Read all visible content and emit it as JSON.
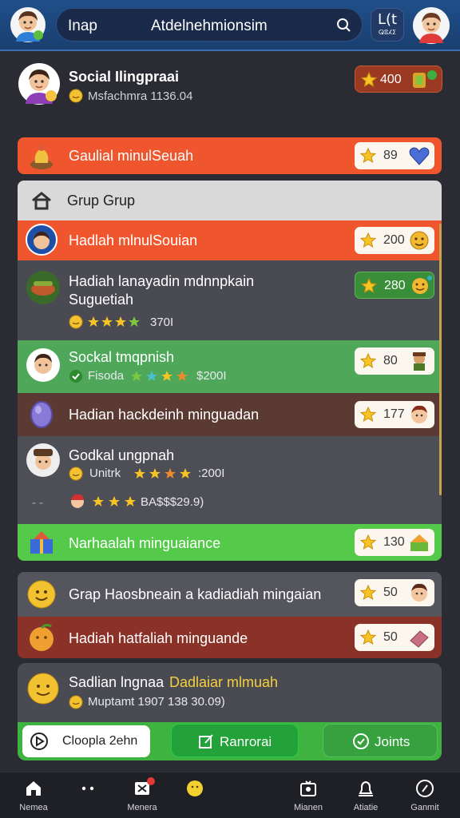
{
  "header": {
    "app_name": "Inap",
    "search_title": "Atdelnehmionsim",
    "lang_big": "L(t",
    "lang_small": "ⵕⵓⵃⵉ"
  },
  "profile": {
    "name": "Social Ilingpraai",
    "subtitle": "Msfachmra 1136.04",
    "score": "400"
  },
  "rows": {
    "row1": {
      "label": "Gaulial minulSeuah",
      "score": "89"
    },
    "group_title": "Grup Grup",
    "row2": {
      "label": "Hadlah mlnulSouian",
      "score": "200"
    },
    "row3": {
      "label_line1": "Hadiah lanayadin mdnnpkain",
      "label_line2": "Suguetiah",
      "meta": "370I",
      "score": "280"
    },
    "row4": {
      "label": "Sockal tmqpnish",
      "meta_label": "Fisoda",
      "meta": "$200I",
      "score": "80"
    },
    "row5": {
      "label": "Hadian hackdeinh minguadan",
      "score": "177"
    },
    "row6": {
      "label": "Godkal ungpnah",
      "meta_label": "Unitrk",
      "meta": ":200I",
      "sub_meta": "BA$$$29.9)",
      "sub_prefix": "- -"
    },
    "row7": {
      "label": "Narhaalah minguaiance",
      "score": "130"
    },
    "row8": {
      "label": "Grap Haosbneain a kadiadiah mingaian",
      "score": "50"
    },
    "row9": {
      "label": "Hadiah hatfaliah minguande",
      "score": "50"
    },
    "row10": {
      "label_a": "Sadlian lngnaa",
      "label_b": "Dadlaiar mlmuah",
      "meta": "Muptamt 1907 138 30.09)"
    }
  },
  "actions": {
    "white_button": "Cloopla 2ehn",
    "green_button": "Ranrorai",
    "green2_button": "Joints"
  },
  "nav": {
    "home": "Nemea",
    "more": "",
    "menu": "Menera",
    "center": "",
    "messages": "Mianen",
    "alerts": "Atiatie",
    "account": "Ganmit"
  },
  "colors": {
    "orange": "#f0562e",
    "green": "#4fbd4f",
    "dark_row": "#4a4a52",
    "brown_row": "#5a3a32",
    "maroon_row": "#8a3228"
  }
}
